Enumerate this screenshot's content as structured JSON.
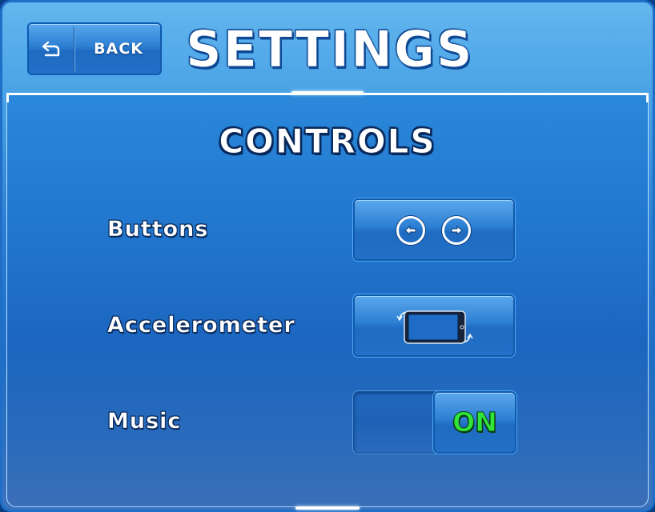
{
  "header": {
    "back_label": "BACK",
    "back_icon": "return-arrow-icon",
    "title": "SETTINGS"
  },
  "section": {
    "title": "CONTROLS"
  },
  "controls": {
    "buttons": {
      "label": "Buttons",
      "icons": [
        "left-arrow-icon",
        "right-arrow-icon"
      ]
    },
    "accelerometer": {
      "label": "Accelerometer",
      "icon": "tilt-phone-icon"
    },
    "music": {
      "label": "Music",
      "state": "ON",
      "enabled": true
    }
  },
  "colors": {
    "background_top": "#63b7ee",
    "background_bottom": "#1f6ec4",
    "button": "#2c7fd2",
    "on_text": "#31e43a"
  }
}
